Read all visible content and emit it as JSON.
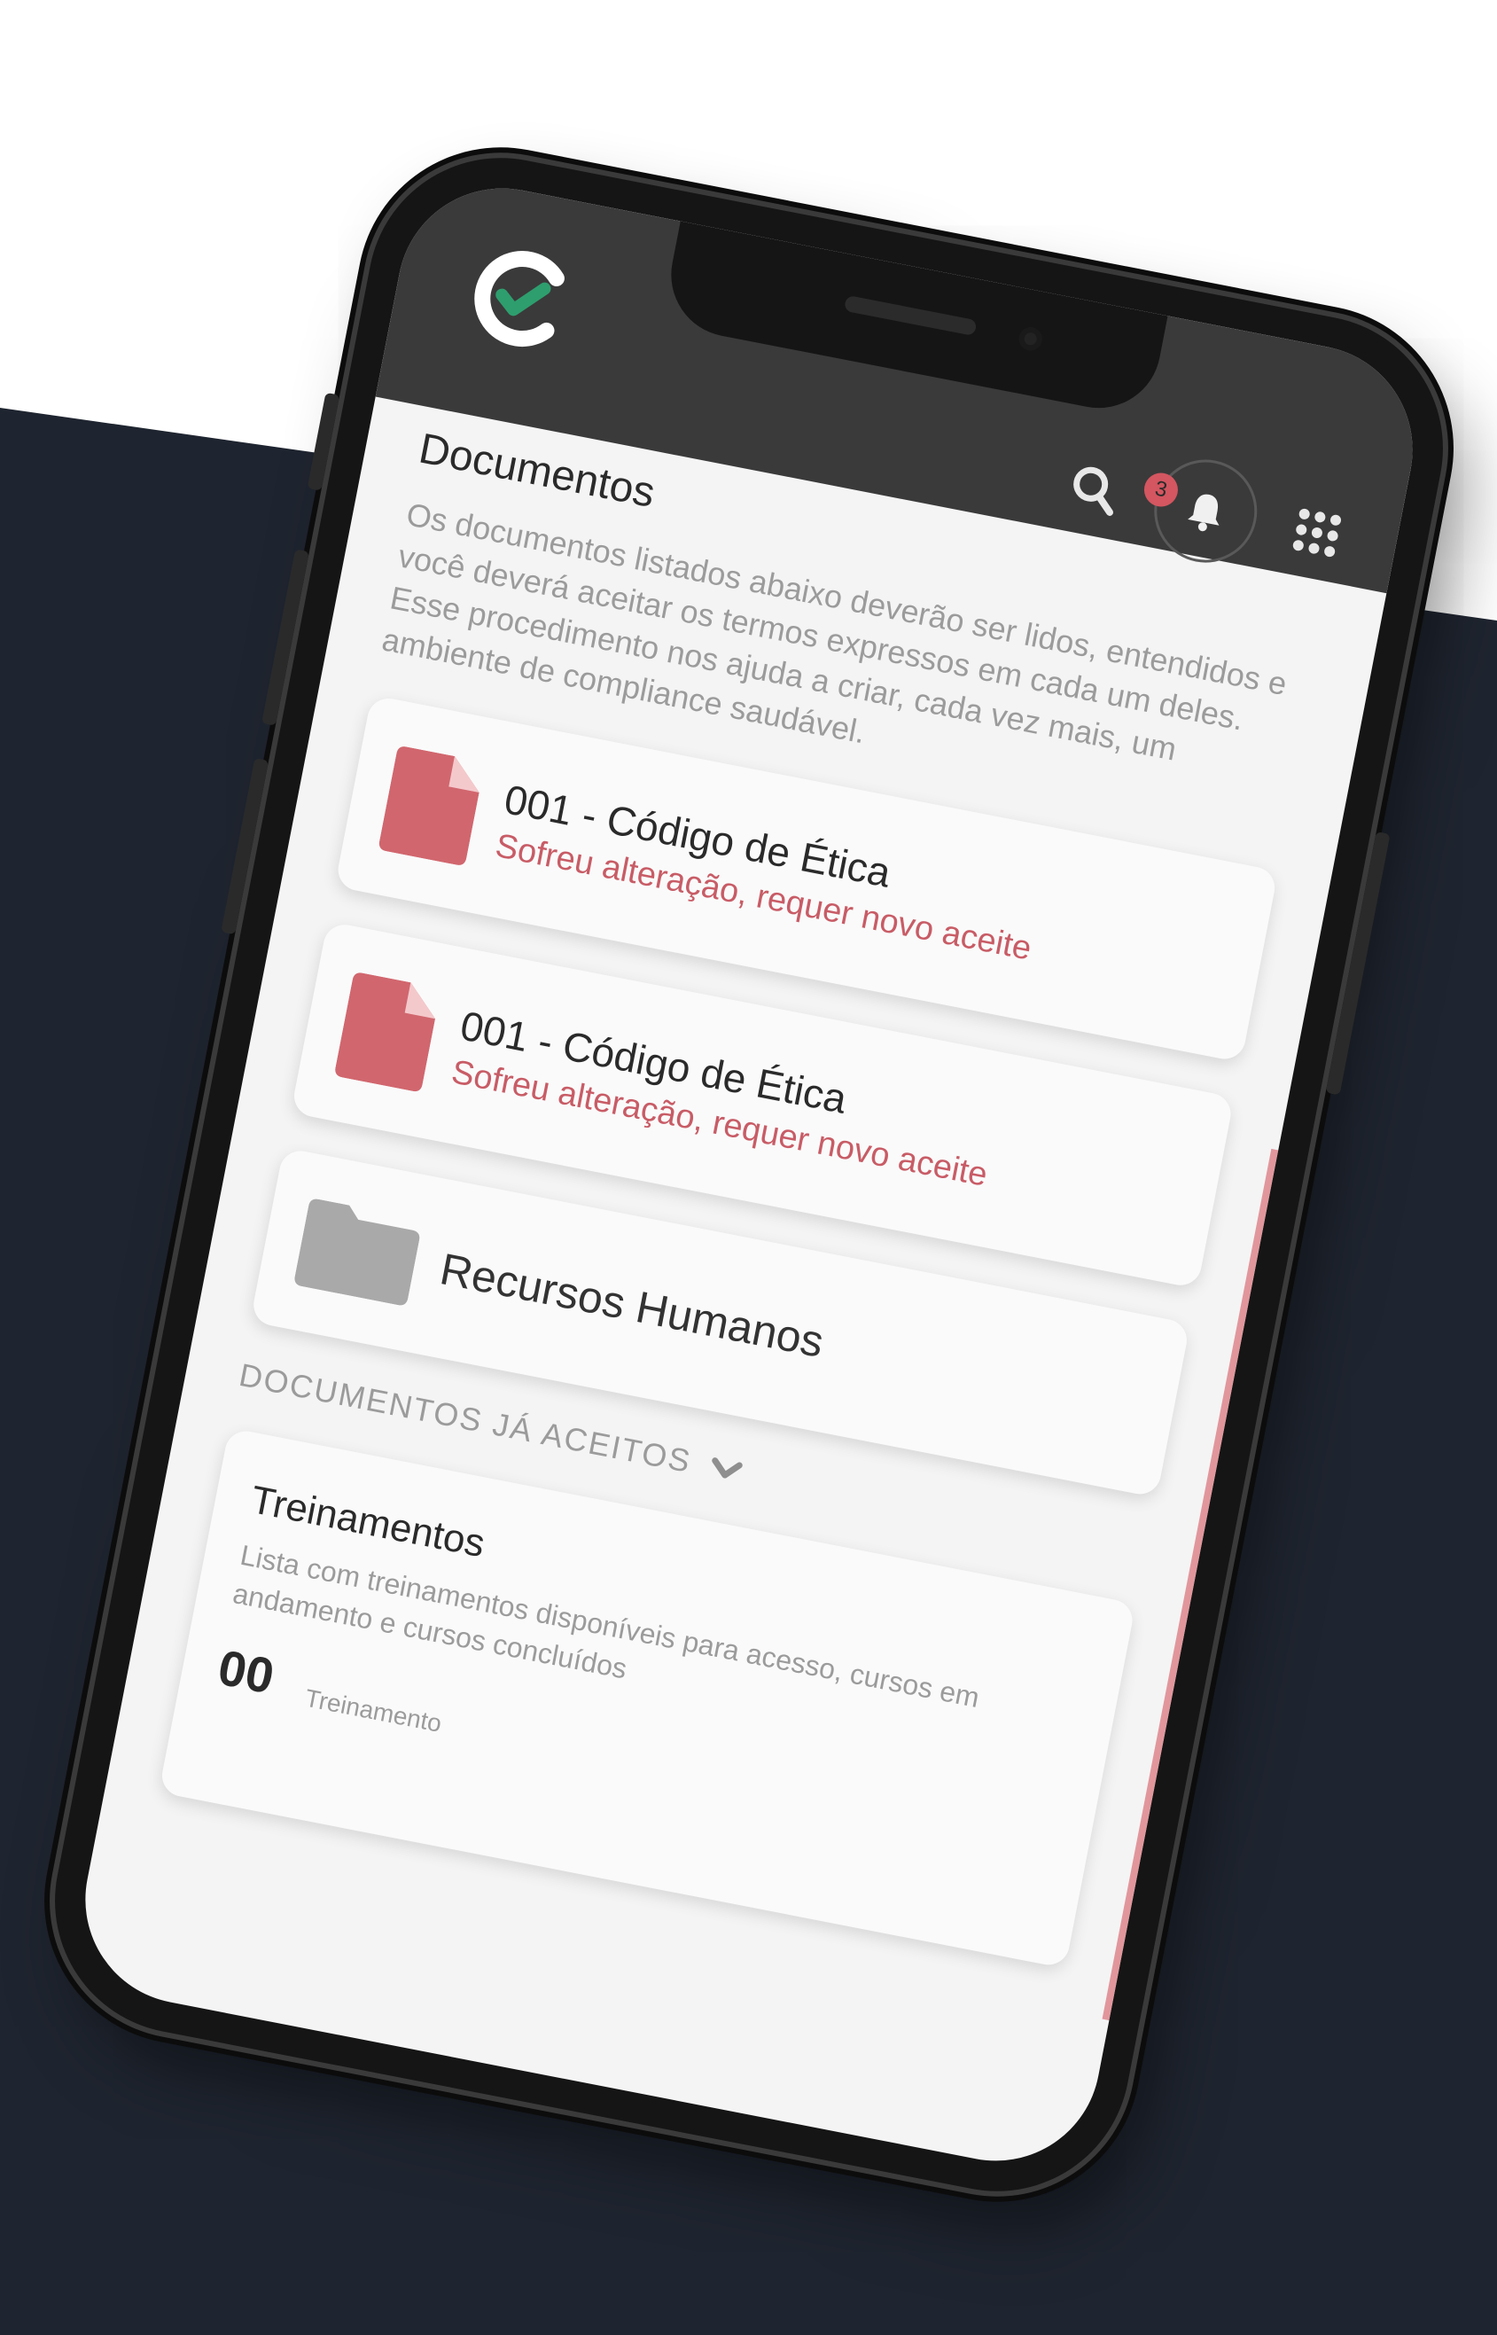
{
  "app": {
    "notification_count": "3",
    "colors": {
      "brand_green": "#2e9e6e",
      "alert_red": "#c85c66",
      "topbar": "#3a3a3a",
      "backdrop": "#1f2530"
    },
    "icons": {
      "logo": "c-check-logo-icon",
      "search": "search-icon",
      "bell": "bell-icon",
      "apps": "apps-grid-icon"
    }
  },
  "documents": {
    "title": "Documentos",
    "description": "Os documentos listados abaixo deverão ser lidos, entendidos e você deverá aceitar os termos expressos em cada um deles. Esse procedimento nos ajuda a criar, cada vez mais, um ambiente de compliance saudável.",
    "items": [
      {
        "title": "001 - Código de Ética",
        "status": "Sofreu alteração, requer novo aceite",
        "icon": "file-icon"
      },
      {
        "title": "001 - Código de Ética",
        "status": "Sofreu alteração, requer novo aceite",
        "icon": "file-icon"
      }
    ],
    "folder": {
      "title": "Recursos Humanos",
      "icon": "folder-icon"
    },
    "accepted_section_label": "DOCUMENTOS JÁ ACEITOS"
  },
  "trainings": {
    "title": "Treinamentos",
    "description": "Lista com treinamentos disponíveis para acesso, cursos em andamento e cursos concluídos",
    "count": "00",
    "count_label": "Treinamento"
  }
}
